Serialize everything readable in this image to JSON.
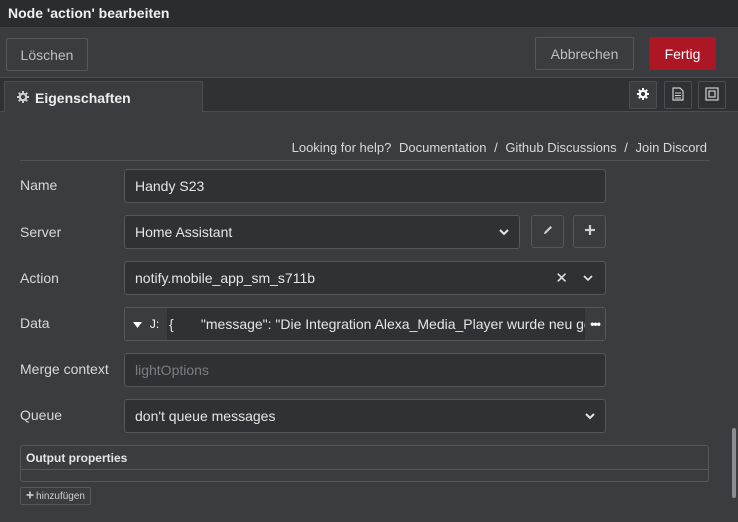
{
  "title": "Node 'action' bearbeiten",
  "toolbar": {
    "delete_label": "Löschen",
    "cancel_label": "Abbrechen",
    "done_label": "Fertig"
  },
  "tabs": {
    "properties_label": "Eigenschaften",
    "icons": [
      "gear-icon",
      "document-icon",
      "frame-icon"
    ]
  },
  "help": {
    "prefix": "Looking for help?",
    "documentation": "Documentation",
    "separator": "/",
    "github": "Github Discussions",
    "discord": "Join Discord"
  },
  "form": {
    "name": {
      "label": "Name",
      "value": "Handy S23"
    },
    "server": {
      "label": "Server",
      "value": "Home Assistant"
    },
    "action": {
      "label": "Action",
      "value": "notify.mobile_app_sm_s711b",
      "clear_symbol": "✕"
    },
    "data": {
      "label": "Data",
      "type_glyph": "J:",
      "value": "{       \"message\": \"Die Integration Alexa_Media_Player wurde neu gestartet\"",
      "expand_symbol": "•••"
    },
    "merge_context": {
      "label": "Merge context",
      "placeholder": "lightOptions"
    },
    "queue": {
      "label": "Queue",
      "value": "don't queue messages"
    }
  },
  "output": {
    "header": "Output properties",
    "add_label": "hinzufügen"
  },
  "colors": {
    "accent": "#ad1625",
    "background": "#3a3c40",
    "field_background": "#2f3134"
  }
}
